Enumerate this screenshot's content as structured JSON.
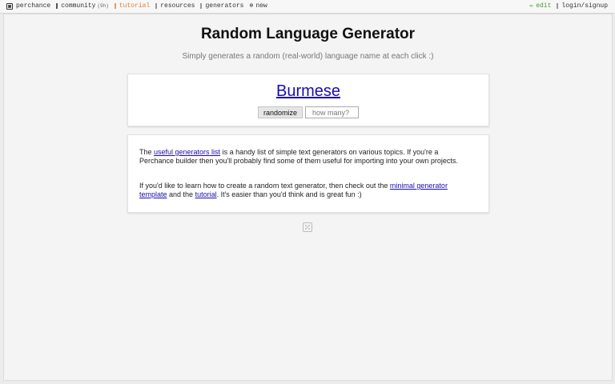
{
  "nav": {
    "left": [
      {
        "label": "perchance",
        "icon": "dice-icon"
      },
      {
        "label": "community",
        "sub": "(9h)",
        "icon": "community-icon"
      },
      {
        "label": "tutorial",
        "icon": "tutorial-icon"
      },
      {
        "label": "resources",
        "icon": "resources-icon"
      },
      {
        "label": "generators",
        "icon": "generators-icon"
      },
      {
        "label": "new",
        "icon": "plus-circle-icon"
      }
    ],
    "right": [
      {
        "label": "edit",
        "icon": "pencil-icon"
      },
      {
        "label": "login/signup",
        "icon": "user-icon"
      }
    ]
  },
  "page": {
    "title": "Random Language Generator",
    "subtitle": "Simply generates a random (real-world) language name at each click :)"
  },
  "output": {
    "result": "Burmese",
    "button_label": "randomize",
    "count_placeholder": "how many?"
  },
  "info": {
    "p1_pre": "The ",
    "p1_link": "useful generators list",
    "p1_post": " is a handy list of simple text generators on various topics. If you're a Perchance builder then you'll probably find some of them useful for importing into your own projects.",
    "p2_pre": "If you'd like to learn how to create a random text generator, then check out the ",
    "p2_link1": "minimal generator template",
    "p2_mid": " and the ",
    "p2_link2": "tutorial",
    "p2_post": ". It's easier than you'd think and is great fun :)"
  },
  "colors": {
    "link": "#1a0dab",
    "tutorial_nav": "#d9822b",
    "edit_nav": "#4a9a3a"
  }
}
